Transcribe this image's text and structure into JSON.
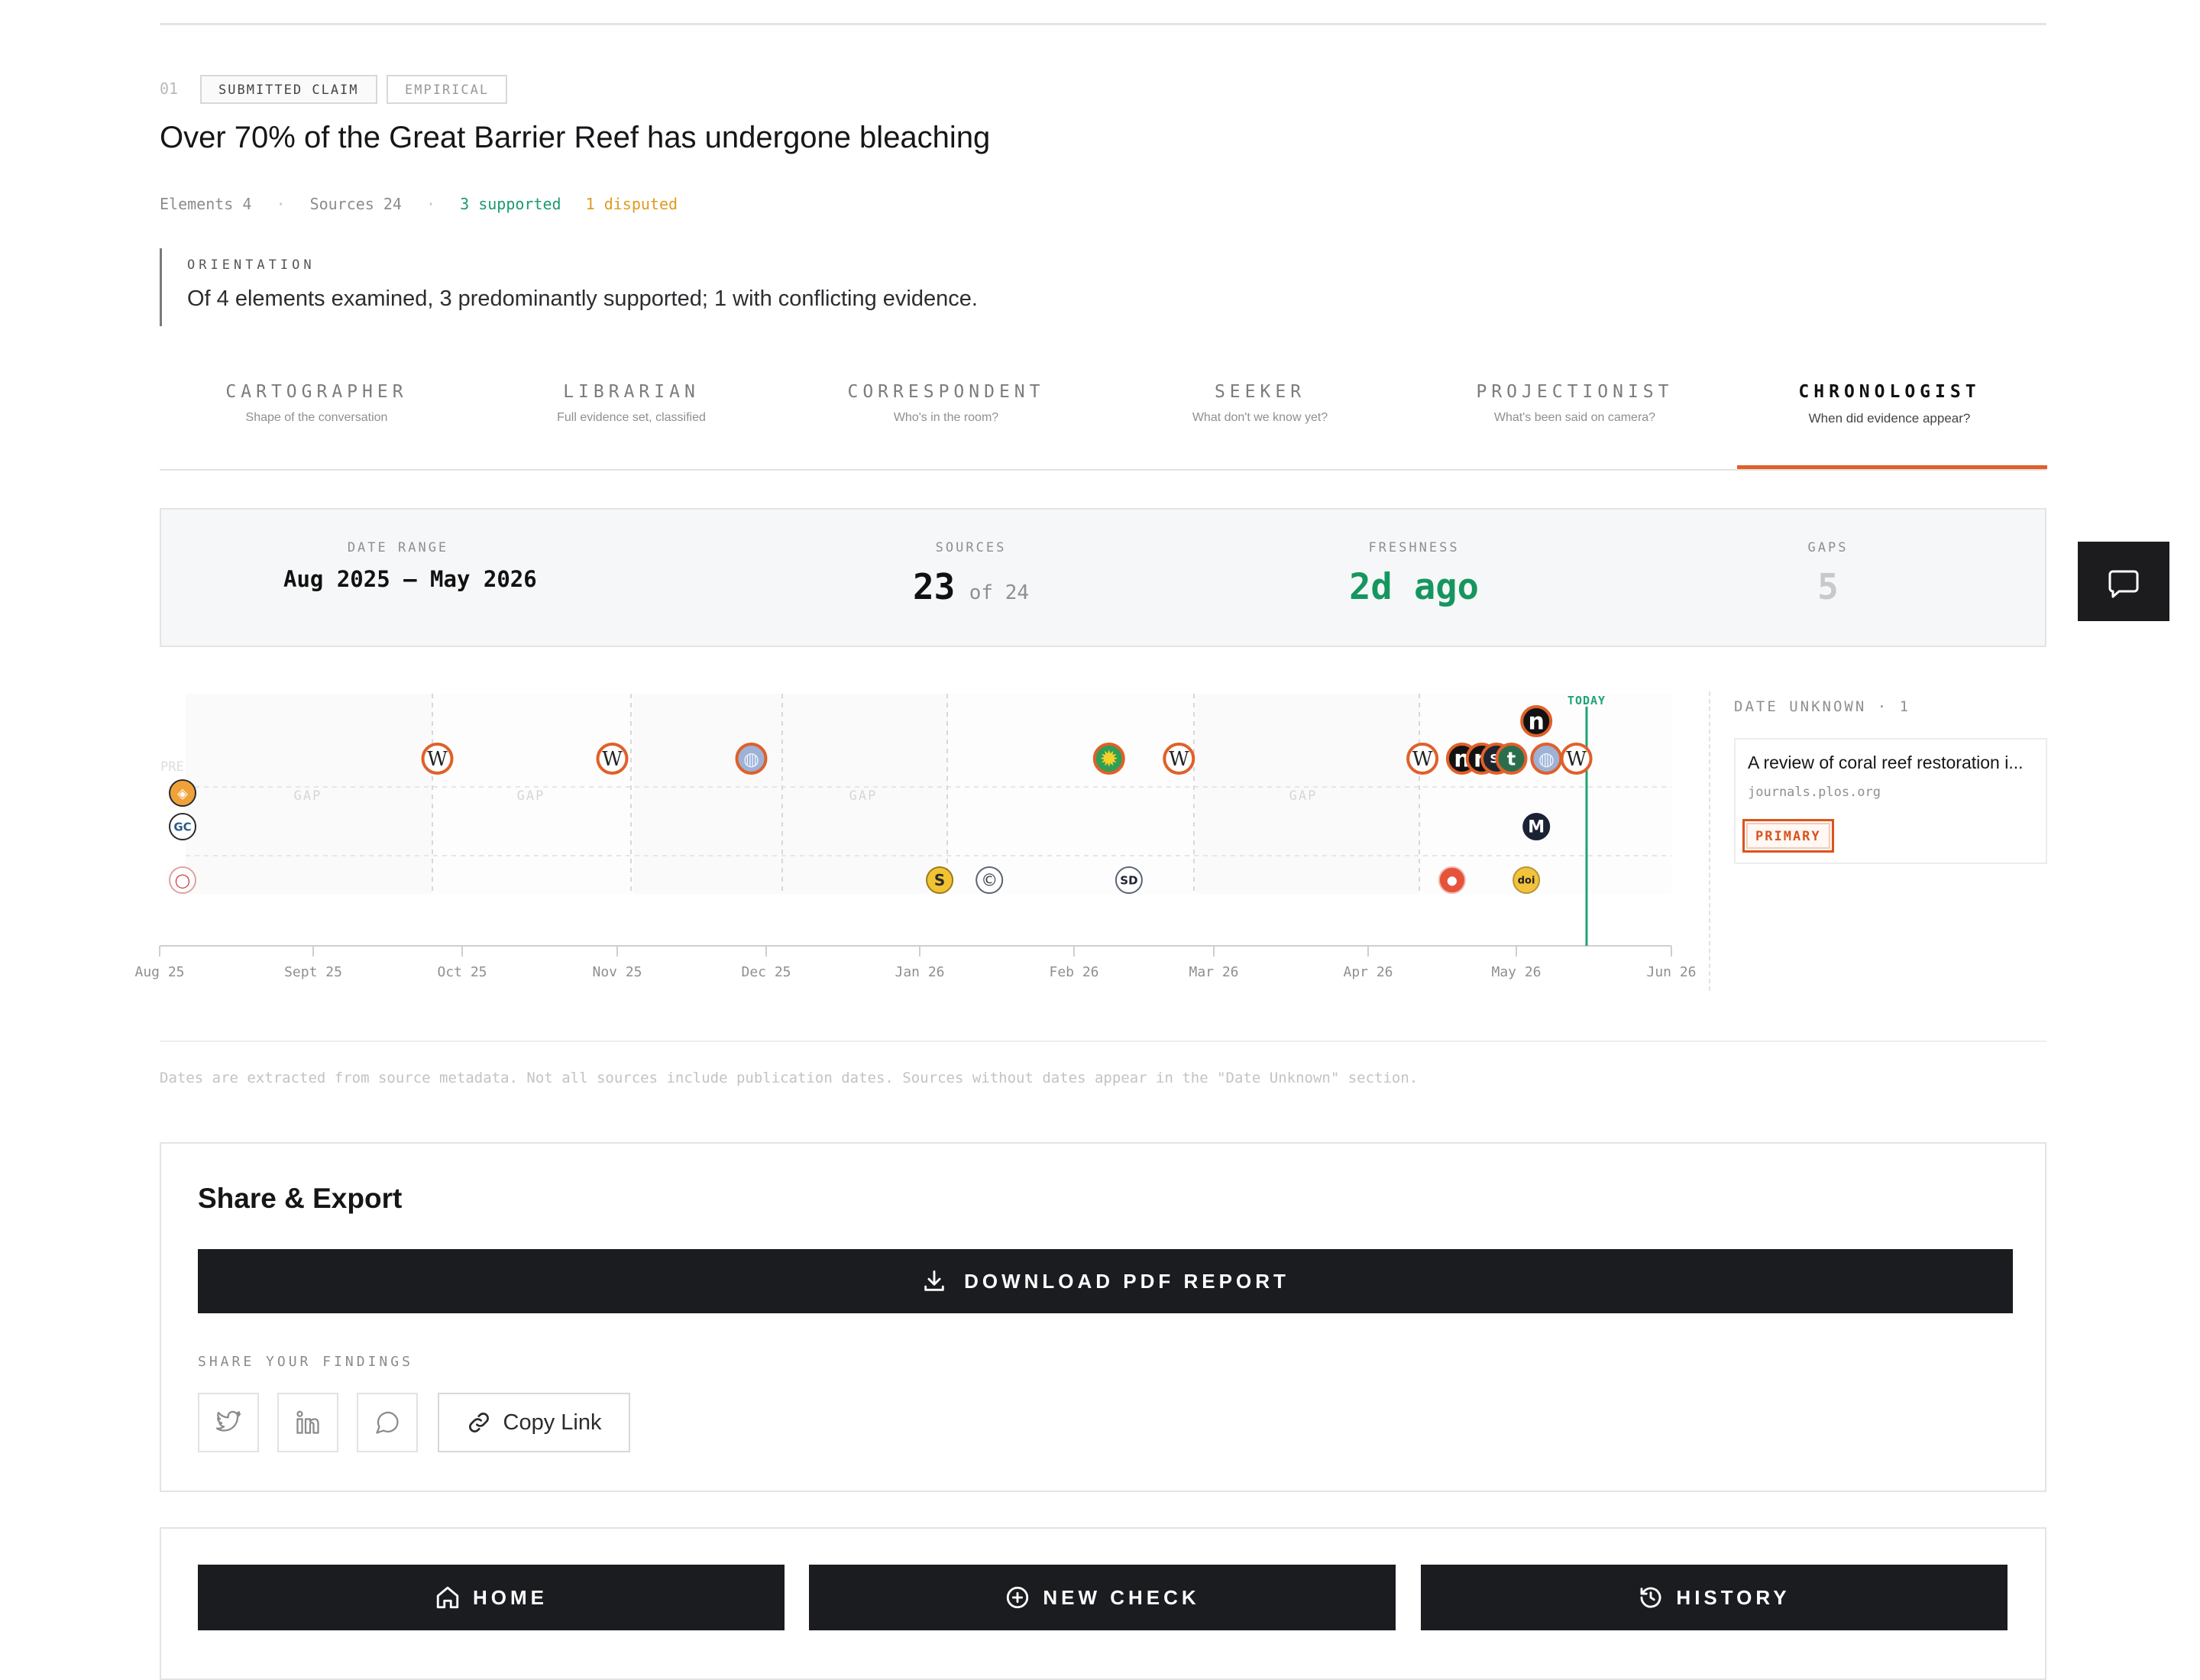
{
  "claim": {
    "number": "01",
    "tags": [
      "SUBMITTED CLAIM",
      "EMPIRICAL"
    ],
    "title": "Over 70% of the Great Barrier Reef has undergone bleaching",
    "stats": {
      "elements": "Elements 4",
      "sources": "Sources 24",
      "supported": "3 supported",
      "disputed": "1 disputed",
      "separator": "·"
    },
    "orientation": {
      "label": "ORIENTATION",
      "text": "Of 4 elements examined, 3 predominantly supported; 1 with conflicting evidence."
    }
  },
  "tabs": [
    {
      "label": "CARTOGRAPHER",
      "sub": "Shape of the conversation"
    },
    {
      "label": "LIBRARIAN",
      "sub": "Full evidence set, classified"
    },
    {
      "label": "CORRESPONDENT",
      "sub": "Who's in the room?"
    },
    {
      "label": "SEEKER",
      "sub": "What don't we know yet?"
    },
    {
      "label": "PROJECTIONIST",
      "sub": "What's been said on camera?"
    },
    {
      "label": "CHRONOLOGIST",
      "sub": "When did evidence appear?",
      "active": true
    }
  ],
  "metrics": {
    "date_range": {
      "label": "DATE RANGE",
      "value": "Aug 2025 – May 2026"
    },
    "sources": {
      "label": "SOURCES",
      "value": "23",
      "suffix": "of 24"
    },
    "freshness": {
      "label": "FRESHNESS",
      "value": "2d ago",
      "color": "#16965f"
    },
    "gaps": {
      "label": "GAPS",
      "value": "5"
    }
  },
  "timeline": {
    "today_label": "TODAY",
    "pre_label": "PRE",
    "gap_label": "GAP",
    "axis_ticks": [
      "Aug 25",
      "Sept 25",
      "Oct 25",
      "Nov 25",
      "Dec 25",
      "Jan 26",
      "Feb 26",
      "Mar 26",
      "Apr 26",
      "May 26",
      "Jun 26"
    ],
    "accent": "#e0602a",
    "today_color": "#1ea372",
    "sources": [
      {
        "icon": "generic-orange-source-icon",
        "date": "2025-08",
        "row": 2
      },
      {
        "icon": "gc-source-icon",
        "date": "2025-08",
        "row": 3
      },
      {
        "icon": "chat-bubble-source-icon",
        "date": "2025-08",
        "row": 4
      },
      {
        "icon": "wikipedia-icon",
        "date": "2025-09-26",
        "row": 1
      },
      {
        "icon": "wikipedia-icon",
        "date": "2025-10-31",
        "row": 1
      },
      {
        "icon": "globe-icon",
        "date": "2025-11-28",
        "row": 1
      },
      {
        "icon": "s-source-icon",
        "date": "2026-01-05",
        "row": 4
      },
      {
        "icon": "c-source-icon",
        "date": "2026-01-15",
        "row": 4
      },
      {
        "icon": "sun-source-icon",
        "date": "2026-02-08",
        "row": 1
      },
      {
        "icon": "sd-source-icon",
        "date": "2026-02-12",
        "row": 4
      },
      {
        "icon": "wikipedia-icon",
        "date": "2026-02-22",
        "row": 1
      },
      {
        "icon": "wikipedia-icon",
        "date": "2026-04-12",
        "row": 1
      },
      {
        "icon": "reddit-icon",
        "date": "2026-04-18",
        "row": 4
      },
      {
        "icon": "n-source-icon",
        "date": "2026-04-20",
        "row": 1
      },
      {
        "icon": "n-source-icon",
        "date": "2026-04-24",
        "row": 1
      },
      {
        "icon": "si-source-icon",
        "date": "2026-04-27",
        "row": 1
      },
      {
        "icon": "t-source-icon",
        "date": "2026-04-30",
        "row": 1
      },
      {
        "icon": "doi-icon",
        "date": "2026-05-03",
        "row": 4
      },
      {
        "icon": "n-source-icon",
        "date": "2026-05-05",
        "row": 0
      },
      {
        "icon": "m-source-icon",
        "date": "2026-05-05",
        "row": 3
      },
      {
        "icon": "globe-icon",
        "date": "2026-05-07",
        "row": 1
      },
      {
        "icon": "wikipedia-icon",
        "date": "2026-05-13",
        "row": 1
      }
    ]
  },
  "date_unknown": {
    "label": "DATE UNKNOWN · 1",
    "item": {
      "title": "A review of coral reef restoration i...",
      "domain": "journals.plos.org",
      "badge": "PRIMARY"
    }
  },
  "footnote": "Dates are extracted from source metadata. Not all sources include publication dates. Sources without dates appear in the \"Date Unknown\" section.",
  "share": {
    "title": "Share & Export",
    "download_label": "DOWNLOAD PDF REPORT",
    "findings_label": "SHARE YOUR FINDINGS",
    "copy_link_label": "Copy Link",
    "icons": [
      "twitter-icon",
      "linkedin-icon",
      "message-circle-icon"
    ]
  },
  "nav": {
    "home": "HOME",
    "new_check": "NEW CHECK",
    "history": "HISTORY"
  }
}
